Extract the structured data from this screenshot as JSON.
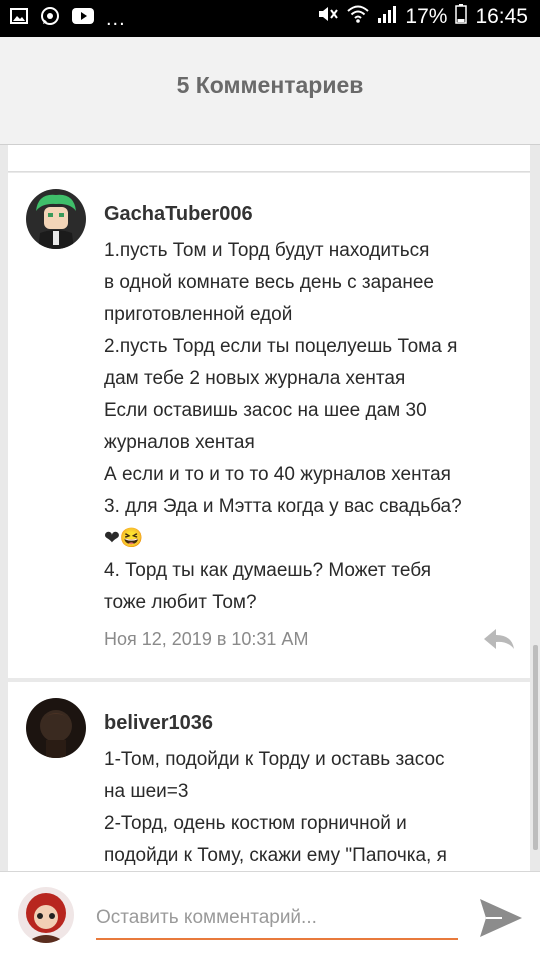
{
  "status_bar": {
    "left_icons": [
      "image-icon",
      "whatsapp-icon",
      "youtube-icon"
    ],
    "more": "...",
    "battery_text": "17%",
    "time": "16:45"
  },
  "header": {
    "title": "5 Комментариев"
  },
  "comments": [
    {
      "author": "GachaTuber006",
      "lines": [
        "1.пусть Том и Торд будут находиться",
        "в одной комнате весь день с заранее",
        "приготовленной едой",
        "2.пусть Торд если ты поцелуешь Тома я",
        "дам тебе 2 новых журнала хентая",
        "Если оставишь засос на шее дам 30",
        "журналов хентая",
        "А если и то и то то 40 журналов хентая",
        "3. для Эда и Мэтта когда у вас свадьба?",
        "❤😆",
        "4. Торд ты как думаешь? Может тебя",
        "тоже любит Том?"
      ],
      "date": "Ноя 12, 2019 в 10:31 AM"
    },
    {
      "author": "beliver1036",
      "lines": [
        "1-Том, подойди к Торду и оставь засос",
        "на шеи=3",
        "2-Торд, одень костюм горничной и",
        "подойди к Тому, скажи ему \"Папочка, я"
      ]
    }
  ],
  "input": {
    "placeholder": "Оставить комментарий..."
  },
  "colors": {
    "accent": "#e87a3c",
    "header_bg": "#f2f2f2",
    "page_bg": "#e9e9e9"
  }
}
